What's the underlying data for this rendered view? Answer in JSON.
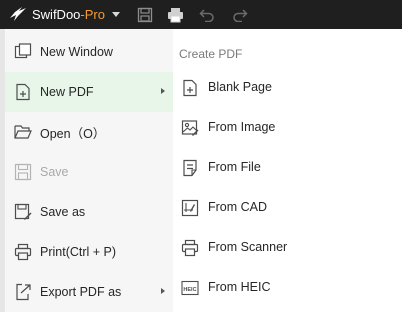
{
  "titlebar": {
    "brand": "SwifDoo",
    "brand_suffix": "-Pro",
    "brand_accent_color": "#f29b38"
  },
  "menu": {
    "items": [
      {
        "label": "New Window",
        "icon": "new-window-icon"
      },
      {
        "label": "New PDF",
        "icon": "new-pdf-icon",
        "active": true,
        "submenu": true
      },
      {
        "label": "Open（O）",
        "icon": "folder-open-icon"
      },
      {
        "label": "Save",
        "icon": "save-icon",
        "disabled": true
      },
      {
        "label": "Save as",
        "icon": "save-as-icon"
      },
      {
        "label": "Print(Ctrl + P)",
        "icon": "print-icon"
      },
      {
        "label": "Export PDF as",
        "icon": "export-icon",
        "submenu": true
      }
    ]
  },
  "submenu": {
    "header": "Create PDF",
    "items": [
      {
        "label": "Blank Page",
        "icon": "blank-page-icon"
      },
      {
        "label": "From Image",
        "icon": "image-icon"
      },
      {
        "label": "From File",
        "icon": "file-icon"
      },
      {
        "label": "From CAD",
        "icon": "cad-icon"
      },
      {
        "label": "From Scanner",
        "icon": "scanner-icon"
      },
      {
        "label": "From HEIC",
        "icon": "heic-icon",
        "icon_text": "HEIC"
      }
    ]
  }
}
